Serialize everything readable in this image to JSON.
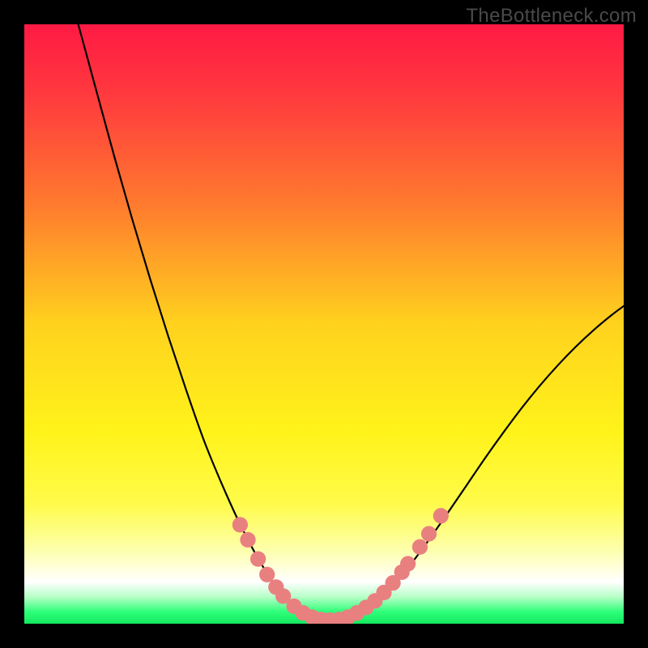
{
  "watermark": "TheBottleneck.com",
  "chart_data": {
    "type": "line",
    "title": "",
    "xlabel": "",
    "ylabel": "",
    "xlim": [
      0,
      100
    ],
    "ylim": [
      0,
      100
    ],
    "grid": false,
    "legend": false,
    "background_gradient_stops": [
      {
        "offset": 0.0,
        "color": "#ff1a44"
      },
      {
        "offset": 0.12,
        "color": "#ff3a3e"
      },
      {
        "offset": 0.3,
        "color": "#ff7a2e"
      },
      {
        "offset": 0.5,
        "color": "#ffd21e"
      },
      {
        "offset": 0.68,
        "color": "#fff31a"
      },
      {
        "offset": 0.8,
        "color": "#fffb4a"
      },
      {
        "offset": 0.88,
        "color": "#fdffb0"
      },
      {
        "offset": 0.93,
        "color": "#ffffff"
      },
      {
        "offset": 0.955,
        "color": "#b8ffc8"
      },
      {
        "offset": 0.98,
        "color": "#2fff7a"
      },
      {
        "offset": 1.0,
        "color": "#14e85f"
      }
    ],
    "series": [
      {
        "name": "left-curve",
        "color": "#000000",
        "points": [
          {
            "x": 9.0,
            "y": 100.0
          },
          {
            "x": 12.0,
            "y": 89.0
          },
          {
            "x": 15.0,
            "y": 78.0
          },
          {
            "x": 18.0,
            "y": 67.5
          },
          {
            "x": 21.0,
            "y": 57.5
          },
          {
            "x": 24.0,
            "y": 48.0
          },
          {
            "x": 27.0,
            "y": 39.0
          },
          {
            "x": 30.0,
            "y": 30.5
          },
          {
            "x": 33.0,
            "y": 23.2
          },
          {
            "x": 36.0,
            "y": 16.6
          },
          {
            "x": 39.0,
            "y": 10.9
          },
          {
            "x": 42.0,
            "y": 6.2
          },
          {
            "x": 45.0,
            "y": 2.8
          },
          {
            "x": 48.0,
            "y": 0.9
          },
          {
            "x": 50.0,
            "y": 0.4
          }
        ]
      },
      {
        "name": "right-curve",
        "color": "#000000",
        "points": [
          {
            "x": 50.0,
            "y": 0.4
          },
          {
            "x": 53.0,
            "y": 0.8
          },
          {
            "x": 56.0,
            "y": 2.0
          },
          {
            "x": 59.0,
            "y": 4.1
          },
          {
            "x": 62.0,
            "y": 7.0
          },
          {
            "x": 65.0,
            "y": 10.6
          },
          {
            "x": 68.0,
            "y": 14.7
          },
          {
            "x": 71.0,
            "y": 19.0
          },
          {
            "x": 74.0,
            "y": 23.4
          },
          {
            "x": 77.0,
            "y": 27.8
          },
          {
            "x": 80.0,
            "y": 32.0
          },
          {
            "x": 83.0,
            "y": 36.0
          },
          {
            "x": 86.0,
            "y": 39.7
          },
          {
            "x": 89.0,
            "y": 43.1
          },
          {
            "x": 92.0,
            "y": 46.2
          },
          {
            "x": 95.0,
            "y": 49.0
          },
          {
            "x": 98.0,
            "y": 51.5
          },
          {
            "x": 100.0,
            "y": 53.0
          }
        ]
      }
    ],
    "markers": {
      "color": "#e98080",
      "radius": 1.3,
      "points": [
        {
          "x": 36.0,
          "y": 16.5
        },
        {
          "x": 37.3,
          "y": 14.0
        },
        {
          "x": 39.0,
          "y": 10.8
        },
        {
          "x": 40.5,
          "y": 8.2
        },
        {
          "x": 42.0,
          "y": 6.1
        },
        {
          "x": 43.2,
          "y": 4.6
        },
        {
          "x": 45.0,
          "y": 2.9
        },
        {
          "x": 46.5,
          "y": 1.8
        },
        {
          "x": 48.0,
          "y": 1.1
        },
        {
          "x": 49.5,
          "y": 0.7
        },
        {
          "x": 51.0,
          "y": 0.6
        },
        {
          "x": 52.5,
          "y": 0.7
        },
        {
          "x": 54.0,
          "y": 1.1
        },
        {
          "x": 55.5,
          "y": 1.8
        },
        {
          "x": 57.0,
          "y": 2.7
        },
        {
          "x": 58.5,
          "y": 3.8
        },
        {
          "x": 60.0,
          "y": 5.2
        },
        {
          "x": 61.5,
          "y": 6.8
        },
        {
          "x": 63.0,
          "y": 8.6
        },
        {
          "x": 64.0,
          "y": 10.0
        },
        {
          "x": 66.0,
          "y": 12.8
        },
        {
          "x": 67.5,
          "y": 15.0
        },
        {
          "x": 69.5,
          "y": 18.0
        }
      ]
    }
  }
}
